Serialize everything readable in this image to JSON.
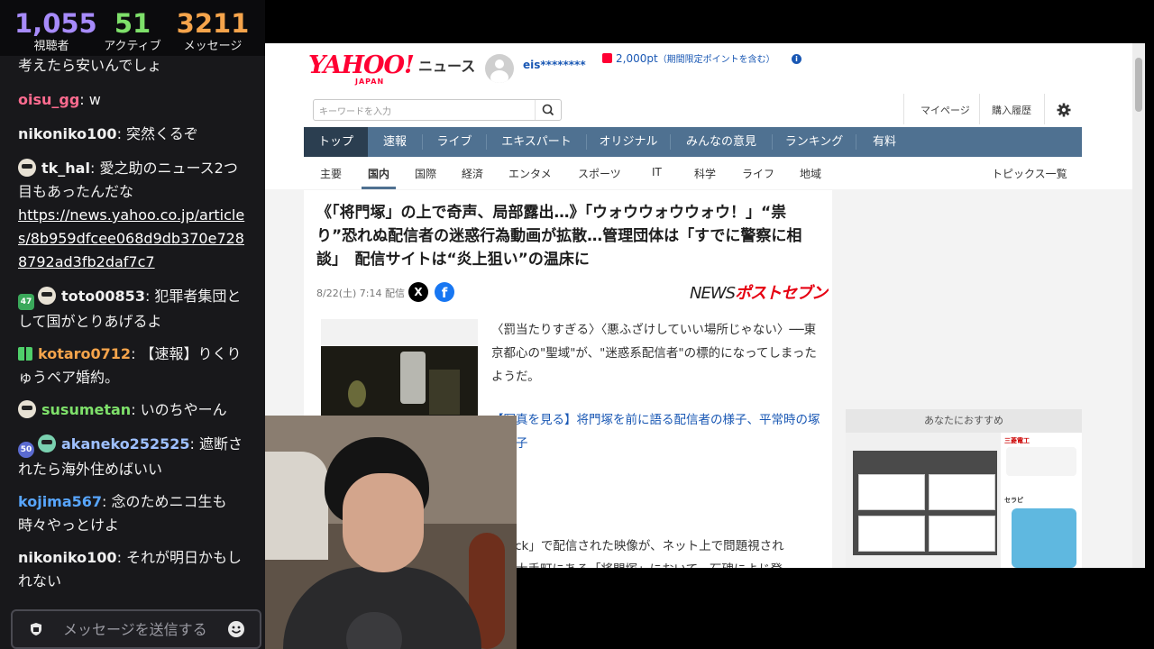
{
  "stats": {
    "viewers": {
      "value": "1,055",
      "label": "視聴者",
      "color": "#a78bfa"
    },
    "active": {
      "value": "51",
      "label": "アクティブ",
      "color": "#7ee06a"
    },
    "messages": {
      "value": "3211",
      "label": "メッセージ",
      "color": "#f5a44b"
    }
  },
  "chat": {
    "messages": [
      {
        "user": "",
        "text": "考えたら安いんでしょ"
      },
      {
        "user": "oisu_gg",
        "user_color": "#ff6b8f",
        "text": " w"
      },
      {
        "user": "nikoniko100",
        "user_color": "#ffffff",
        "text": " 突然くるぞ"
      },
      {
        "user": "tk_hal",
        "user_color": "#ffffff",
        "text": " 愛之助のニュース2つ目もあったんだな",
        "link": "https://news.yahoo.co.jp/articles/8b959dfcee068d9db370e7288792ad3fb2daf7c7"
      },
      {
        "user": "toto00853",
        "user_color": "#ffffff",
        "badge": "47",
        "text": " 犯罪者集団として国がとりあげるよ"
      },
      {
        "user": "kotaro0712",
        "user_color": "#f5a44b",
        "text": " 【速報】りくりゅうペア婚約。"
      },
      {
        "user": "susumetan",
        "user_color": "#7ee06a",
        "text": " いのちやーん"
      },
      {
        "user": "akaneko252525",
        "user_color": "#9ec0ff",
        "badge": "50",
        "text": " 遮断されたら海外住めばいい"
      },
      {
        "user": "kojima567",
        "user_color": "#58a6ff",
        "text": " 念のためニコ生も時々やっとけよ"
      },
      {
        "user": "nikoniko100",
        "user_color": "#ffffff",
        "text": " それが明日かもしれない"
      }
    ],
    "input_placeholder": "メッセージを送信する"
  },
  "yahoo": {
    "logo_text": "YAHOO!",
    "logo_sub": "JAPAN",
    "section": "ニュース",
    "user_name": "eis********",
    "points": "2,000pt",
    "points_note": "（期間限定ポイントを含む）",
    "search_placeholder": "キーワードを入力",
    "util_links": [
      "マイページ",
      "購入履歴"
    ],
    "main_nav": [
      "トップ",
      "速報",
      "ライブ",
      "エキスパート",
      "オリジナル",
      "みんなの意見",
      "ランキング",
      "有料"
    ],
    "sub_nav": [
      "主要",
      "国内",
      "国際",
      "経済",
      "エンタメ",
      "スポーツ",
      "IT",
      "科学",
      "ライフ",
      "地域"
    ],
    "topics_link": "トピックス一覧",
    "article": {
      "title": "《「将門塚」の上で奇声、局部露出…》「ウォウウォウウォウ！」“祟り”恐れぬ配信者の迷惑行為動画が拡散…管理団体は「すでに警察に相談」　配信サイトは“炎上狙い”の温床に",
      "date": "8/22(土) 7:14 配信",
      "source_prefix": "NEWS",
      "source_name": "ポストセブン",
      "para1": "〈罰当たりすぎる〉〈悪ふざけしていい場所じゃない〉──東京都心の\"聖域\"が、\"迷惑系配信者\"の標的になってしまったようだ。",
      "para2_link": "【写真を見る】将門塚を前に語る配信者の様子、平常時の塚の様子",
      "para3": "「Kick」で配信された映像が、ネット上で問題視され",
      "para4": "田区大手町にある「将門塚」において、石碑によじ登"
    },
    "sidebar_heading": "あなたにおすすめ",
    "ad_brand": "三菱電工",
    "ad_brand2": "セラピ"
  },
  "colors": {
    "nav_blue": "#4f7191",
    "nav_active": "#2b3e50",
    "yahoo_red": "#ff0033",
    "link_blue": "#1a58b4"
  }
}
